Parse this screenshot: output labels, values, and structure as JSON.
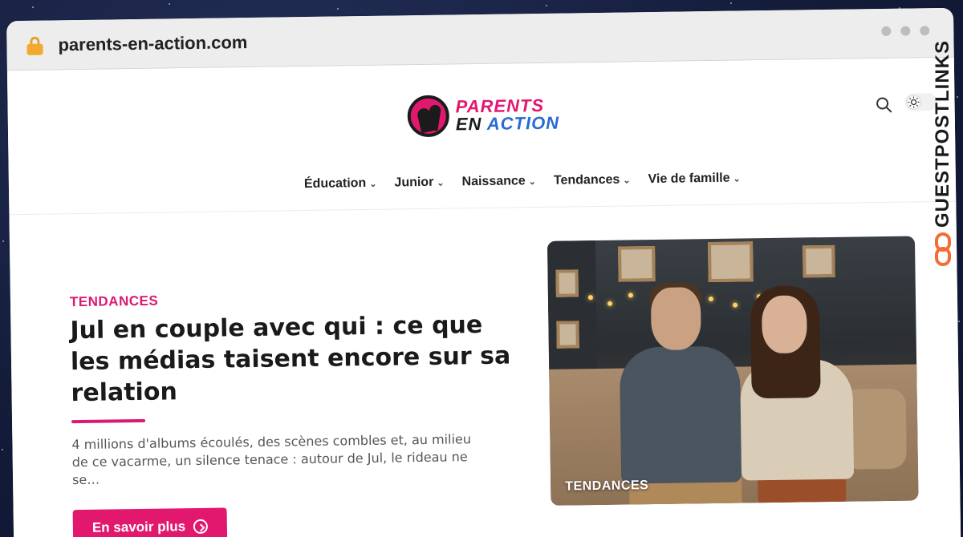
{
  "browser": {
    "url": "parents-en-action.com"
  },
  "site": {
    "logo_line1": "PARENTS",
    "logo_line2_en": "EN",
    "logo_line2_action": "ACTION"
  },
  "nav": {
    "items": [
      {
        "label": "Éducation"
      },
      {
        "label": "Junior"
      },
      {
        "label": "Naissance"
      },
      {
        "label": "Tendances"
      },
      {
        "label": "Vie de famille"
      }
    ]
  },
  "hero": {
    "category": "TENDANCES",
    "title": "Jul en couple avec qui : ce que les médias taisent encore sur sa relation",
    "excerpt": "4 millions d'albums écoulés, des scènes combles et, au milieu de ce vacarme, un silence tenace : autour de Jul, le rideau ne se…",
    "cta_label": "En savoir plus",
    "image_tag": "TENDANCES"
  },
  "side_badge": {
    "text": "GUESTPOSTLINKS"
  },
  "colors": {
    "accent": "#e2186f",
    "logo_blue": "#2a6bd1",
    "badge_orange": "#f36d35"
  }
}
